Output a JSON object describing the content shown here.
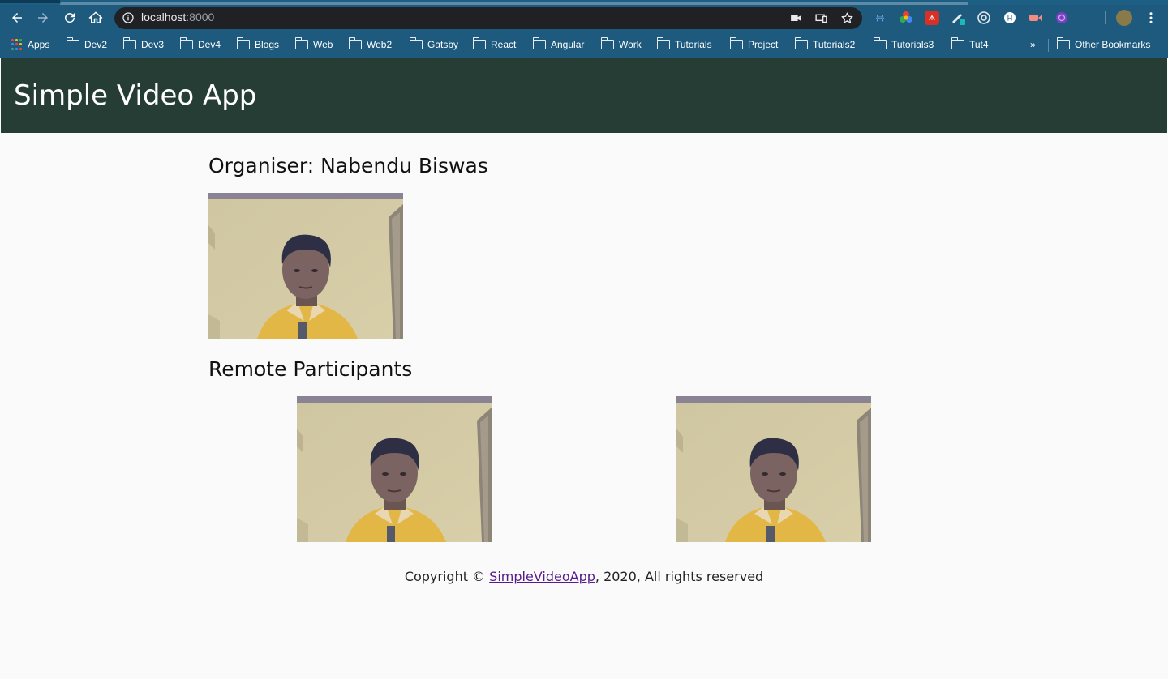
{
  "browser": {
    "url_host": "localhost",
    "url_port": ":8000",
    "bookmarks": [
      {
        "label": "Apps",
        "icon": "apps-grid-icon"
      },
      {
        "label": "Dev2",
        "icon": "folder-icon"
      },
      {
        "label": "Dev3",
        "icon": "folder-icon"
      },
      {
        "label": "Dev4",
        "icon": "folder-icon"
      },
      {
        "label": "Blogs",
        "icon": "folder-icon"
      },
      {
        "label": "Web",
        "icon": "folder-icon"
      },
      {
        "label": "Web2",
        "icon": "folder-icon"
      },
      {
        "label": "Gatsby",
        "icon": "folder-icon"
      },
      {
        "label": "React",
        "icon": "folder-icon"
      },
      {
        "label": "Angular",
        "icon": "folder-icon"
      },
      {
        "label": "Work",
        "icon": "folder-icon"
      },
      {
        "label": "Tutorials",
        "icon": "folder-icon"
      },
      {
        "label": "Project",
        "icon": "folder-icon"
      },
      {
        "label": "Tutorials2",
        "icon": "folder-icon"
      },
      {
        "label": "Tutorials3",
        "icon": "folder-icon"
      },
      {
        "label": "Tut4",
        "icon": "folder-icon"
      }
    ],
    "overflow_label": "»",
    "other_bookmarks": "Other Bookmarks",
    "colors": {
      "toolbar": "#1e5a7e",
      "omnibox": "#202124"
    }
  },
  "app": {
    "title": "Simple Video App",
    "header_color": "#263d36"
  },
  "organiser": {
    "heading": "Organiser: Nabendu Biswas"
  },
  "remote": {
    "heading": "Remote Participants",
    "participant_count": 2
  },
  "footer": {
    "prefix": "Copyright © ",
    "link_text": "SimpleVideoApp",
    "suffix": ", 2020, All rights reserved"
  }
}
